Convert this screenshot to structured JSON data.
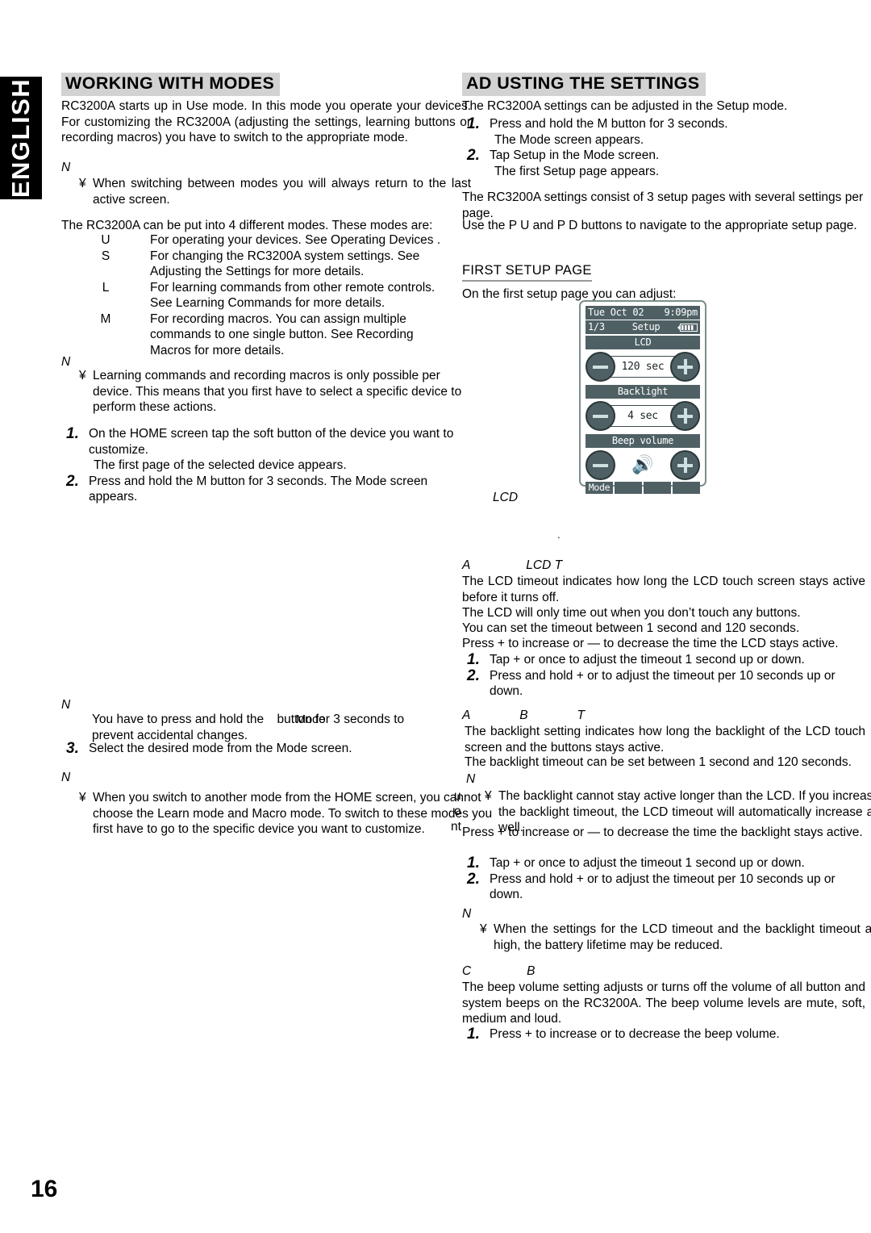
{
  "page": {
    "number": "16",
    "language_tab": "ENGLISH"
  },
  "left_column": {
    "heading": "WORKING WITH MODES",
    "intro": "RC3200A starts up in Use mode. In this mode you operate your devices. For customizing the RC3200A (adjusting the settings, learning buttons or recording macros) you have to switch to the appropriate mode.",
    "note1_marker": "N",
    "note1_bullet": "¥",
    "note1_text": "When switching between modes you will always return to the last active screen.",
    "modes_intro": "The RC3200A can be put into 4 different modes.  These modes are:",
    "modes": [
      {
        "key": "U",
        "desc": "For operating your devices.  See  Operating Devices .",
        "cont": ""
      },
      {
        "key": "S",
        "desc": "For changing the RC3200A system settings. See",
        "cont": "Adjusting the Settings  for more details."
      },
      {
        "key": "L",
        "desc": "For learning commands from other remote controls.",
        "cont": "See  Learning Commands  for more details."
      },
      {
        "key": "M",
        "desc": "For recording macros. You can assign multiple",
        "cont": "commands to one single button.   See  Recording",
        "cont2": "Macros  for more details."
      }
    ],
    "note2_marker": "N",
    "note2_bullet": "¥",
    "note2_text": "Learning commands and recording macros is only possible per device. This means that you first have to select a specific device to perform these actions.",
    "steps": [
      {
        "num": "1.",
        "text": "On the HOME screen tap the soft button of the device you want to customize.",
        "result": "The first page of the selected device appears."
      },
      {
        "num": "2.",
        "text": "Press and hold the M        button for 3 seconds. The Mode screen appears.",
        "result": ""
      }
    ],
    "note3_marker": "N",
    "note3_text_a": "You have to press and hold the",
    "note3_overlap": "Mode",
    "note3_text_b": "button for 3 seconds to",
    "note3_text_c": "prevent accidental changes.",
    "step3": {
      "num": "3.",
      "text": "Select the desired mode from the Mode screen."
    },
    "note4_marker": "N",
    "note4_bullet": "¥",
    "note4_text": "When you switch to another mode from the HOME screen, you cannot choose the Learn mode and Macro mode. To switch to these modes you first have to go to the specific device you want to customize."
  },
  "right_column": {
    "heading": "AD USTING THE SETTINGS",
    "intro": "The RC3200A settings can be adjusted in the Setup mode.",
    "steps": [
      {
        "num": "1.",
        "text": "Press and hold the M        button for 3 seconds.",
        "result": "The Mode screen appears."
      },
      {
        "num": "2.",
        "text": "Tap Setup in the Mode screen.",
        "result": "The first Setup page appears."
      }
    ],
    "pages_intro": "The RC3200A settings consist of 3 setup pages with several settings per page.",
    "navigate": "Use  the  P        U    and  P        D         buttons  to  navigate  to  the appropriate setup page.",
    "first_setup_heading": "FIRST SETUP PAGE",
    "first_setup_intro": "On the first setup page you can adjust:",
    "caption_lcd": "LCD",
    "caption_dot": ".",
    "lcd_timeout": {
      "heading_a": "A",
      "heading_b": "LCD T",
      "p1": "The LCD timeout indicates how long the LCD touch screen stays active before it turns off.",
      "p2": "The LCD will only time out when you don’t touch any buttons.",
      "p3": "You can set the timeout between 1 second and 120 seconds.",
      "p4": "Press  +  to increase or  —  to decrease the time the LCD stays active.",
      "steps": [
        {
          "num": "1.",
          "text": "Tap  +  or      once to adjust the timeout 1 second up or down."
        },
        {
          "num": "2.",
          "text": "Press and hold  +  or       to adjust the timeout per 10 seconds up or down."
        }
      ]
    },
    "backlight": {
      "heading_a": "A",
      "heading_b": "B",
      "heading_c": "T",
      "p1": "The backlight setting indicates how long the backlight of the LCD touch screen and the buttons stays active.",
      "p2": "The backlight timeout can be set between 1 second and 120 seconds.",
      "note_marker": "N",
      "note_bullet": "¥",
      "note_text": "The backlight cannot stay active longer than the LCD. If you increase  the  backlight  timeout,   the  LCD  timeout  will automatically increase as well.",
      "p3": "Press  +   to increase or  —  to decrease the time the backlight stays active.",
      "steps": [
        {
          "num": "1.",
          "text": "Tap  +  or      once to adjust the timeout 1 second up or down."
        },
        {
          "num": "2.",
          "text": "Press and hold  +  or       to adjust the timeout per 10 seconds up or down."
        }
      ],
      "note2_marker": "N",
      "note2_bullet": "¥",
      "note2_text": "When  the  settings  for  the  LCD  timeout  and  the  backlight timeout are high, the battery lifetime may be reduced."
    },
    "beep": {
      "heading_a": "C",
      "heading_b": "B",
      "p1": "The beep volume setting adjusts or turns off the volume of all button and system beeps on the RC3200A. The beep volume levels are mute, soft, medium and loud.",
      "steps": [
        {
          "num": "1.",
          "text": "Press  +  to increase or       to decrease the beep volume."
        }
      ]
    },
    "overflow": {
      "l1": "u",
      "l2": "o",
      "l3": "nt"
    }
  },
  "device_screen": {
    "date": "Tue Oct 02",
    "time": "9:09pm",
    "page_indicator": "1/3",
    "mode_title": "Setup",
    "battery_icon": "battery-icon",
    "sections": [
      {
        "label": "LCD",
        "value": "120 sec",
        "minus": "−",
        "plus": "+"
      },
      {
        "label": "Backlight",
        "value": "4 sec",
        "minus": "−",
        "plus": "+"
      },
      {
        "label": "Beep volume",
        "value": "",
        "icon": "speaker-icon",
        "minus": "−",
        "plus": "+"
      }
    ],
    "soft_buttons": [
      "Mode",
      "",
      "",
      ""
    ]
  }
}
